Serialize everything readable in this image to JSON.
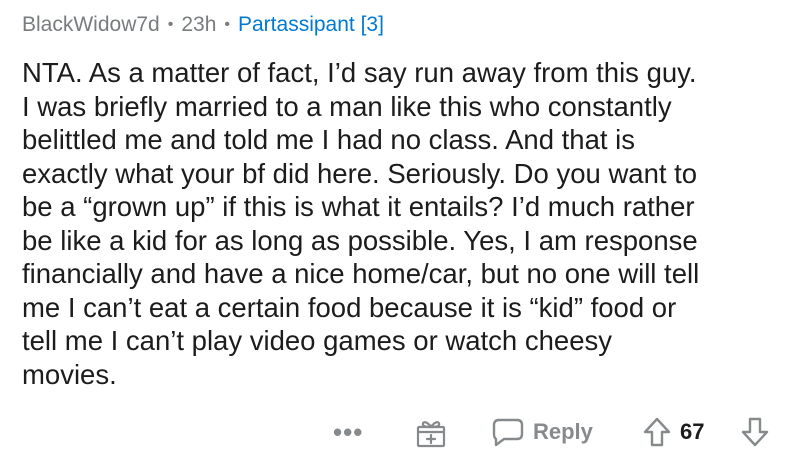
{
  "comment": {
    "author": "BlackWidow7d",
    "separator": "•",
    "age": "23h",
    "flair": "Partassipant [3]",
    "lines": [
      "NTA. As a matter of fact, I’d say run away from this guy.",
      "I was briefly married to a man like this who constantly",
      "belittled me and told me I had no class. And that is",
      "exactly what your bf did here. Seriously. Do you want to",
      "be a “grown up” if this is what it entails? I’d much rather",
      "be like a kid for as long as possible. Yes, I am response",
      "financially and have a nice home/car, but no one will tell",
      "me I can’t eat a certain food because it is “kid” food or",
      "tell me I can’t play video games or watch cheesy",
      "movies."
    ]
  },
  "actions": {
    "more_label": "•••",
    "award_icon": "gift-award-icon",
    "reply_icon": "speech-bubble-icon",
    "reply_label": "Reply",
    "upvote_icon": "arrow-up-icon",
    "score": "67",
    "downvote_icon": "arrow-down-icon"
  },
  "colors": {
    "meta": "#787c7e",
    "flair": "#0079d3",
    "text": "#1c1c1c",
    "icon": "#878a8c"
  }
}
